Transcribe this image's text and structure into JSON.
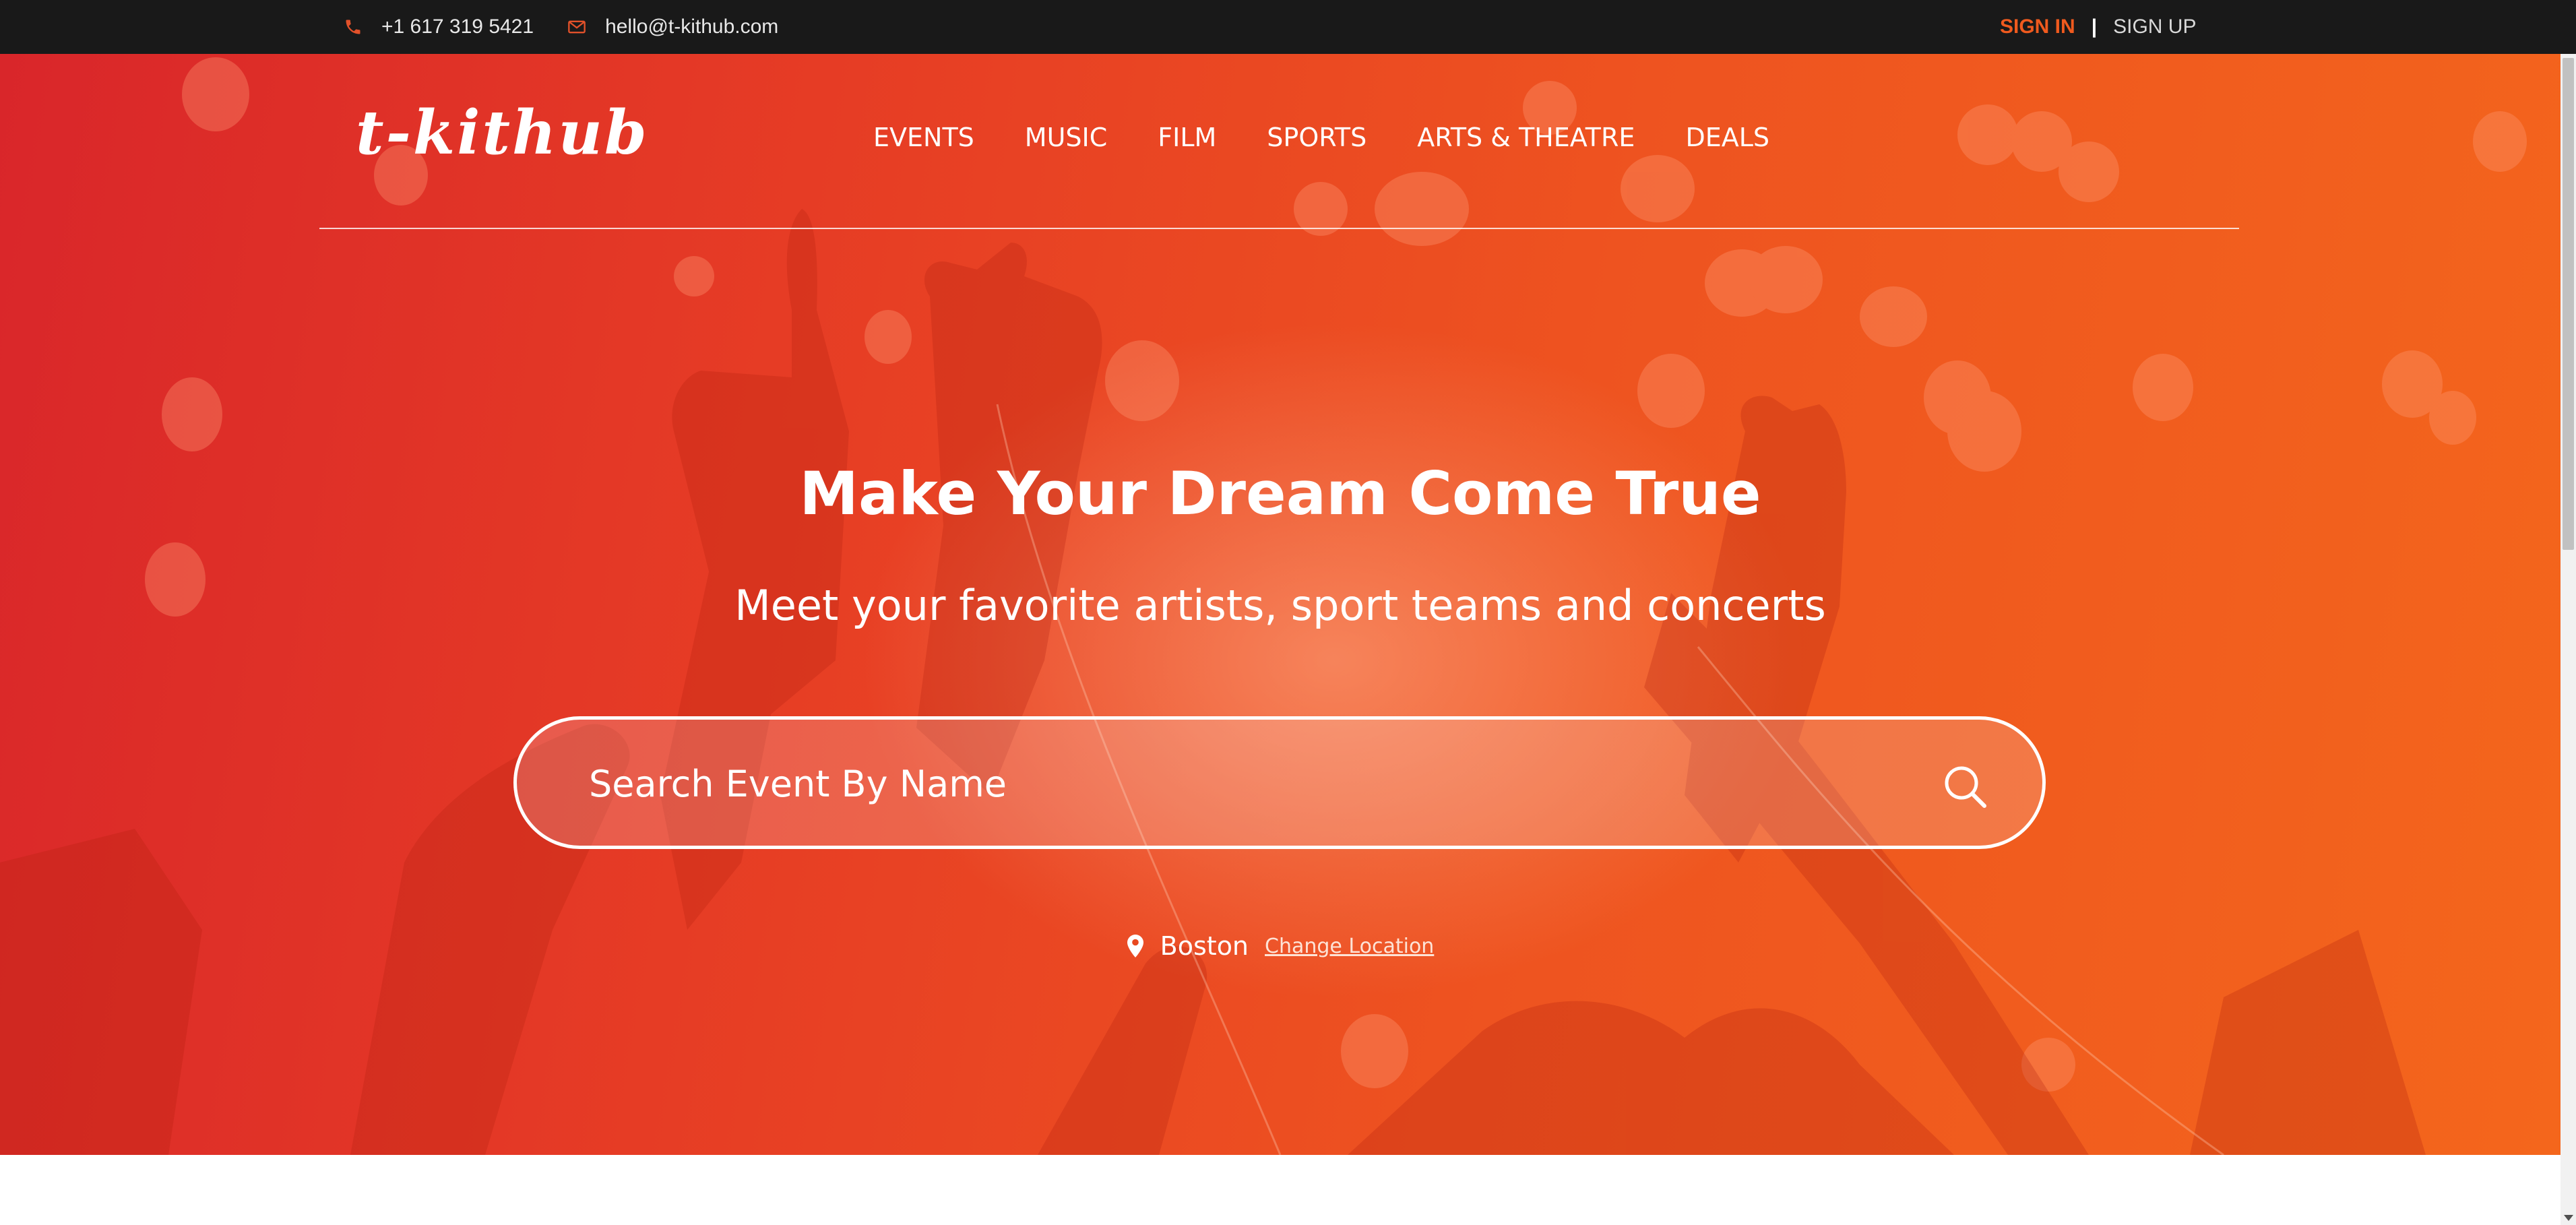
{
  "topbar": {
    "phone": "+1 617 319 5421",
    "email": "hello@t-kithub.com",
    "sign_in": "SIGN IN",
    "separator": "|",
    "sign_up": "SIGN UP",
    "icons": {
      "phone": "phone-icon",
      "email": "envelope-icon"
    },
    "accent_color": "#f05a1e"
  },
  "header": {
    "logo": "t-kithub",
    "nav": [
      {
        "label": "EVENTS"
      },
      {
        "label": "MUSIC"
      },
      {
        "label": "FILM"
      },
      {
        "label": "SPORTS"
      },
      {
        "label": "ARTS & THEATRE"
      },
      {
        "label": "DEALS"
      }
    ]
  },
  "hero": {
    "title": "Make Your Dream Come True",
    "subtitle": "Meet your favorite artists, sport teams and concerts",
    "search": {
      "placeholder": "Search Event By Name",
      "value": "",
      "icon": "search-icon"
    },
    "location": {
      "city": "Boston",
      "change_label": "Change Location",
      "icon": "map-pin-icon"
    },
    "colors": {
      "gradient_start": "#d9262a",
      "gradient_end": "#f4661c"
    }
  }
}
